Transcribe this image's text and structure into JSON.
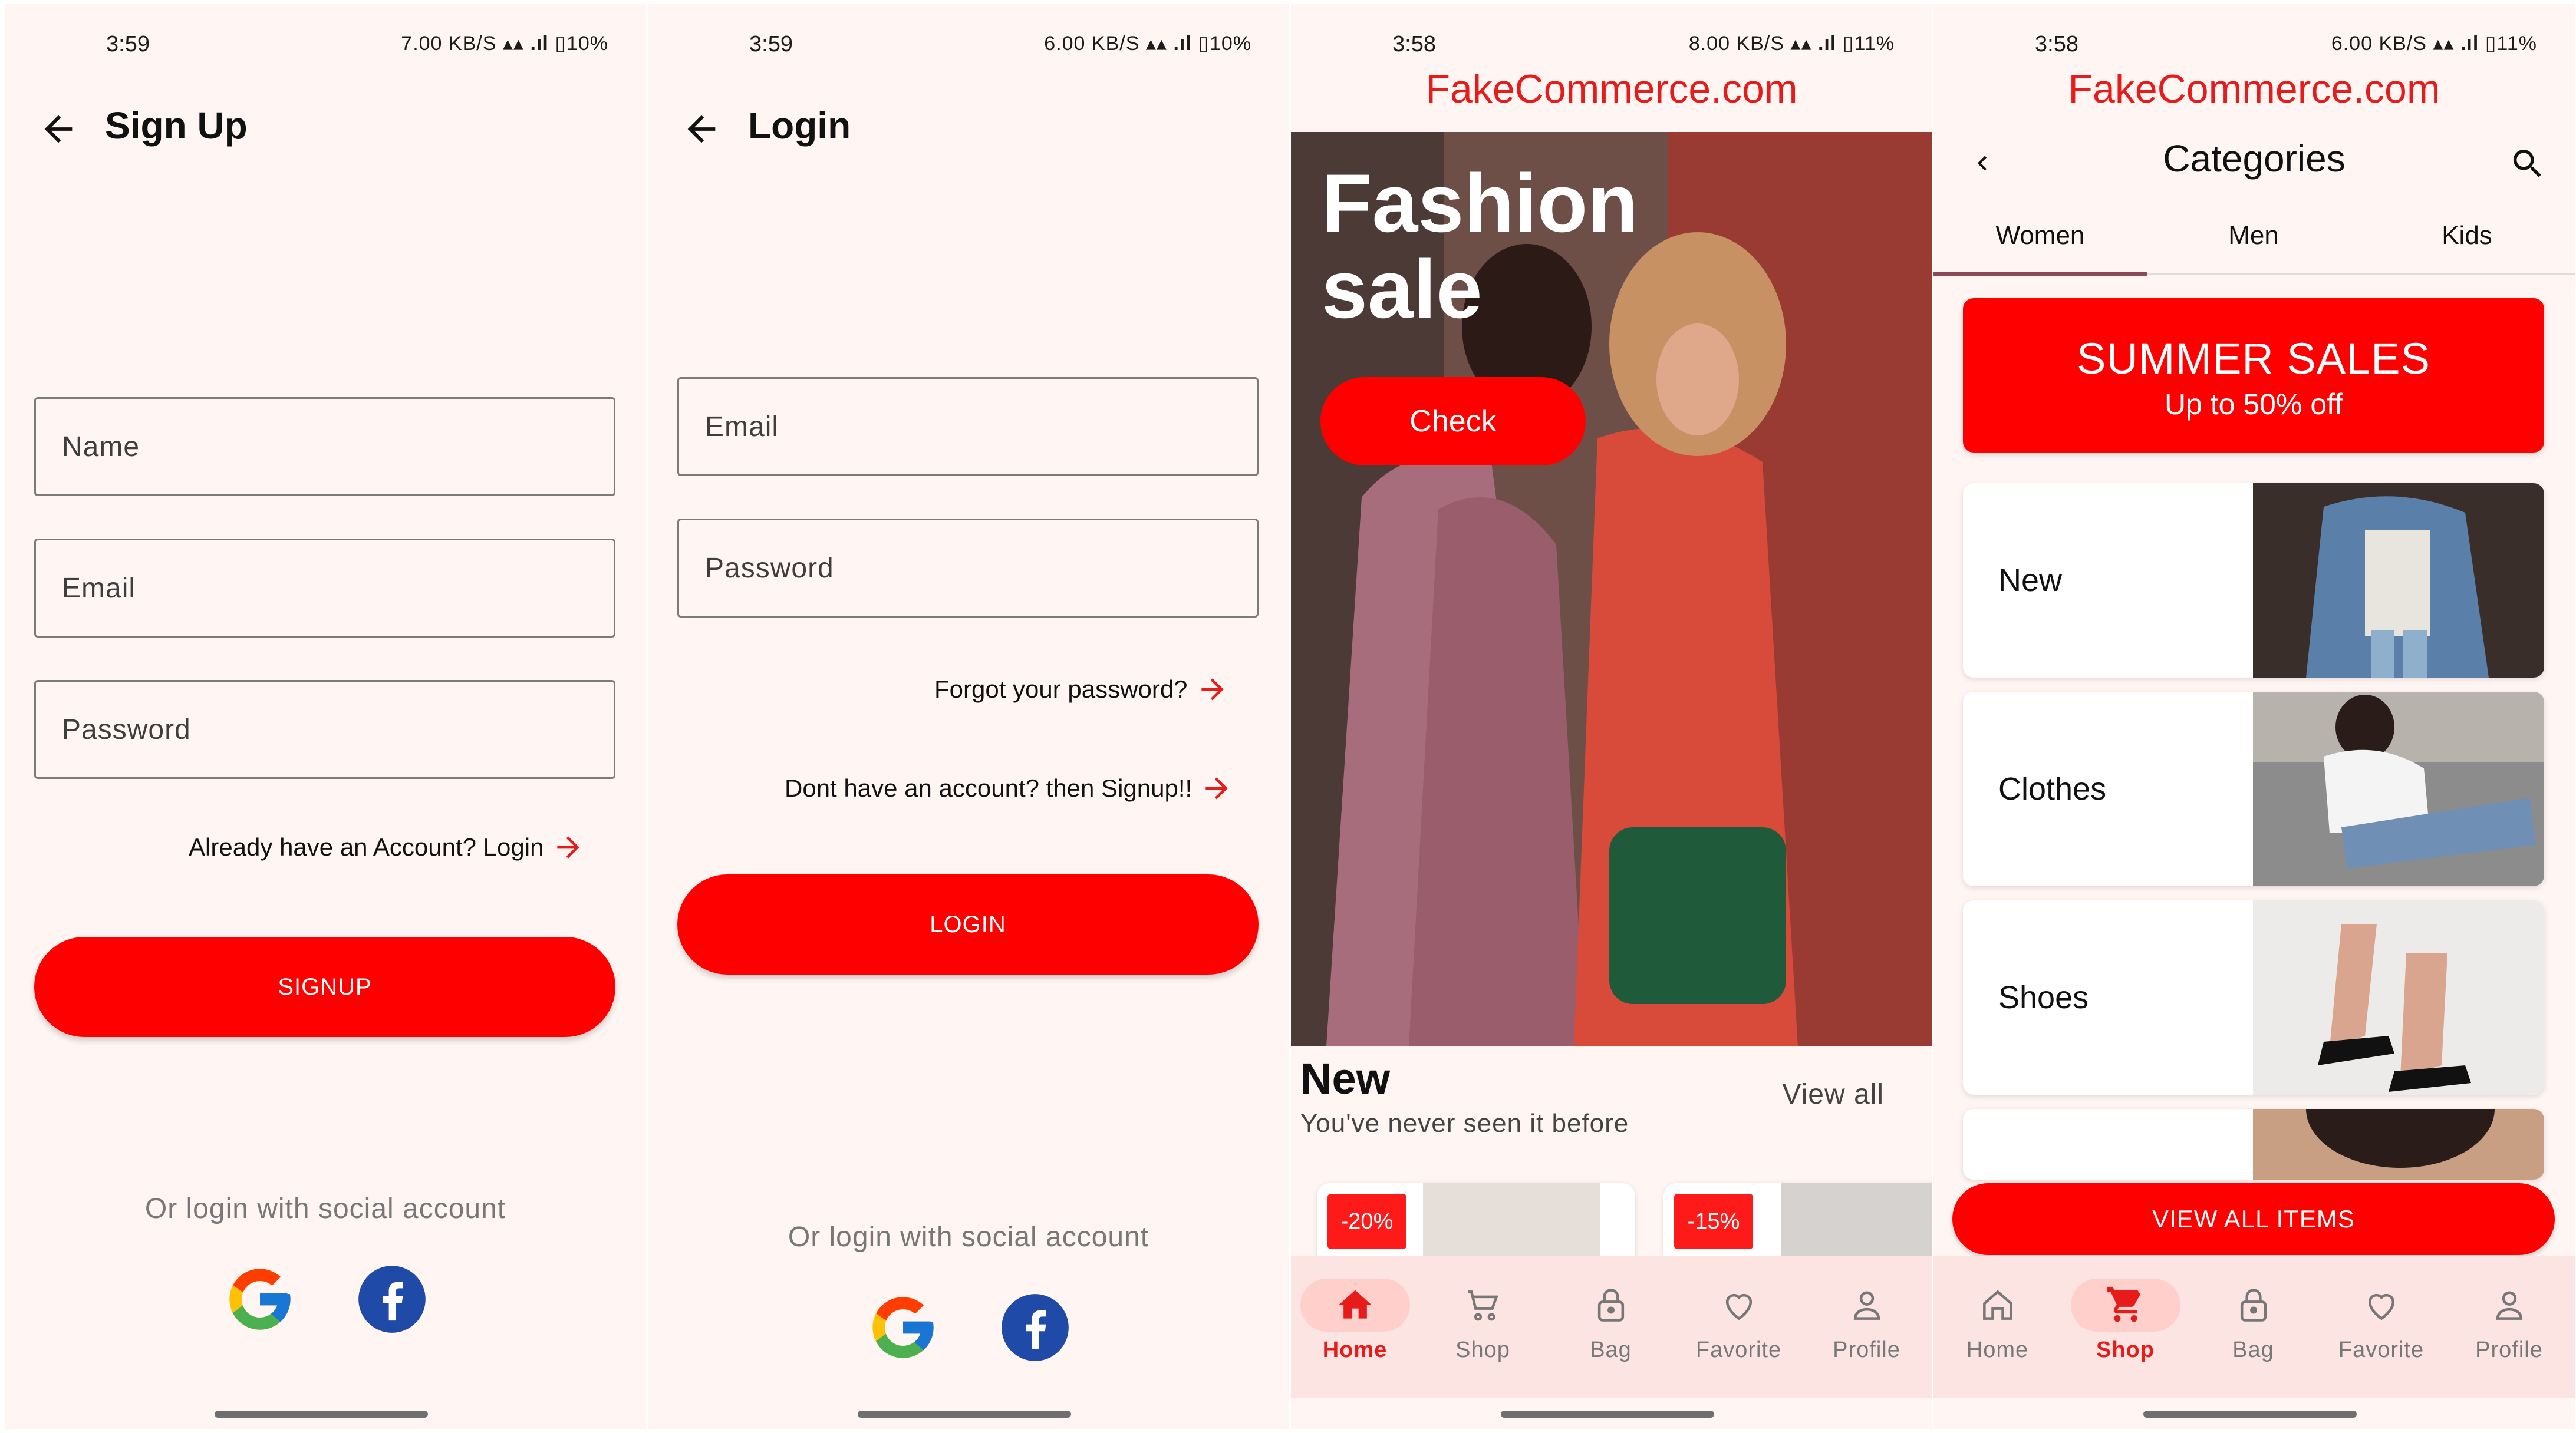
{
  "colors": {
    "accent": "#ff0000",
    "brand_text": "#e81b1b",
    "screen_bg": "#fff5f3",
    "nav_bg": "#fbe4e2"
  },
  "signup": {
    "status_time": "3:59",
    "status_speed": "7.00 KB/S",
    "status_battery": "10%",
    "title": "Sign Up",
    "name_placeholder": "Name",
    "email_placeholder": "Email",
    "password_placeholder": "Password",
    "login_link": "Already have an Account? Login",
    "signup_button": "SIGNUP",
    "social_text": "Or login with social account"
  },
  "login": {
    "status_time": "3:59",
    "status_speed": "6.00 KB/S",
    "status_battery": "10%",
    "title": "Login",
    "email_placeholder": "Email",
    "password_placeholder": "Password",
    "forgot_link": "Forgot your password?",
    "signup_link": "Dont have an account? then Signup!!",
    "login_button": "LOGIN",
    "social_text": "Or login with social account"
  },
  "home": {
    "status_time": "3:58",
    "status_speed": "8.00 KB/S",
    "status_battery": "11%",
    "brand": "FakeCommerce.com",
    "hero_title": "Fashion sale",
    "check_button": "Check",
    "section_title": "New",
    "section_subtitle": "You've never seen it before",
    "view_all": "View all",
    "products": [
      {
        "discount": "-20%"
      },
      {
        "discount": "-15%"
      }
    ],
    "nav": [
      {
        "label": "Home",
        "icon": "home-icon"
      },
      {
        "label": "Shop",
        "icon": "cart-icon"
      },
      {
        "label": "Bag",
        "icon": "bag-icon"
      },
      {
        "label": "Favorite",
        "icon": "heart-icon"
      },
      {
        "label": "Profile",
        "icon": "profile-icon"
      }
    ],
    "active_nav": "Home"
  },
  "categories": {
    "status_time": "3:58",
    "status_speed": "6.00 KB/S",
    "status_battery": "11%",
    "brand": "FakeCommerce.com",
    "title": "Categories",
    "tabs": [
      "Women",
      "Men",
      "Kids"
    ],
    "active_tab": "Women",
    "promo_title": "SUMMER SALES",
    "promo_subtitle": "Up to 50% off",
    "items": [
      "New",
      "Clothes",
      "Shoes"
    ],
    "view_all_button": "VIEW ALL ITEMS",
    "nav": [
      {
        "label": "Home",
        "icon": "home-icon"
      },
      {
        "label": "Shop",
        "icon": "cart-icon"
      },
      {
        "label": "Bag",
        "icon": "bag-icon"
      },
      {
        "label": "Favorite",
        "icon": "heart-icon"
      },
      {
        "label": "Profile",
        "icon": "profile-icon"
      }
    ],
    "active_nav": "Shop"
  }
}
